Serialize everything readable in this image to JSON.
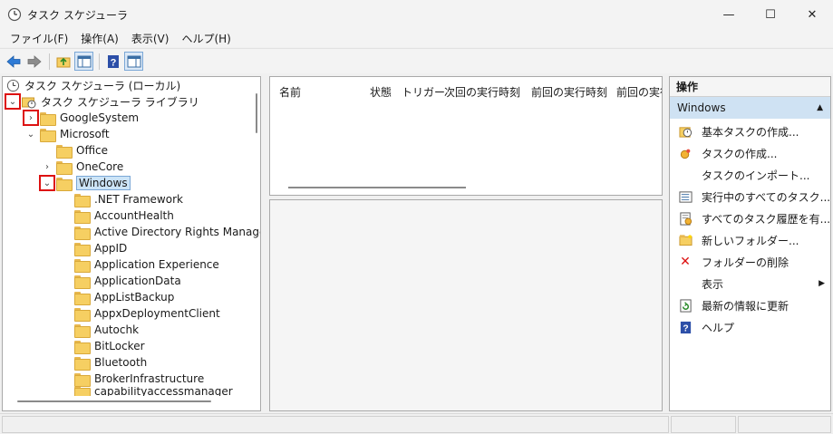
{
  "window": {
    "title": "タスク スケジューラ",
    "minimize": "—",
    "maximize": "☐",
    "close": "✕"
  },
  "menu": [
    {
      "label": "ファイル(F)"
    },
    {
      "label": "操作(A)"
    },
    {
      "label": "表示(V)"
    },
    {
      "label": "ヘルプ(H)"
    }
  ],
  "toolbar": {
    "buttons": [
      "back-arrow-icon",
      "forward-arrow-icon",
      "up-folder-icon",
      "show-hide-tree-icon",
      "help-icon",
      "show-hide-action-pane-icon"
    ]
  },
  "tree": {
    "root": "タスク スケジューラ (ローカル)",
    "library": "タスク スケジューラ ライブラリ",
    "google": "GoogleSystem",
    "microsoft": "Microsoft",
    "office": "Office",
    "onecore": "OneCore",
    "windows": "Windows",
    "children": [
      ".NET Framework",
      "AccountHealth",
      "Active Directory Rights Managem",
      "AppID",
      "Application Experience",
      "ApplicationData",
      "AppListBackup",
      "AppxDeploymentClient",
      "Autochk",
      "BitLocker",
      "Bluetooth",
      "BrokerInfrastructure",
      "capabilityaccessmanager"
    ]
  },
  "task_list": {
    "columns": [
      "名前",
      "状態",
      "トリガー",
      "次回の実行時刻",
      "前回の実行時刻",
      "前回の実行"
    ]
  },
  "actions": {
    "header": "操作",
    "section": "Windows",
    "items": [
      {
        "label": "基本タスクの作成...",
        "icon": "basic-task-icon"
      },
      {
        "label": "タスクの作成...",
        "icon": "create-task-icon"
      },
      {
        "label": "タスクのインポート...",
        "icon": ""
      },
      {
        "label": "実行中のすべてのタスク...",
        "icon": "running-tasks-icon"
      },
      {
        "label": "すべてのタスク履歴を有...",
        "icon": "task-history-icon"
      },
      {
        "label": "新しいフォルダー...",
        "icon": "new-folder-icon"
      },
      {
        "label": "フォルダーの削除",
        "icon": "delete-icon"
      },
      {
        "label": "表示",
        "icon": ""
      },
      {
        "label": "最新の情報に更新",
        "icon": "refresh-icon"
      },
      {
        "label": "ヘルプ",
        "icon": "help-icon"
      }
    ]
  },
  "colors": {
    "selection": "#cce4f7",
    "highlight_box": "#dd1111",
    "section_bg": "#cfe2f3"
  }
}
